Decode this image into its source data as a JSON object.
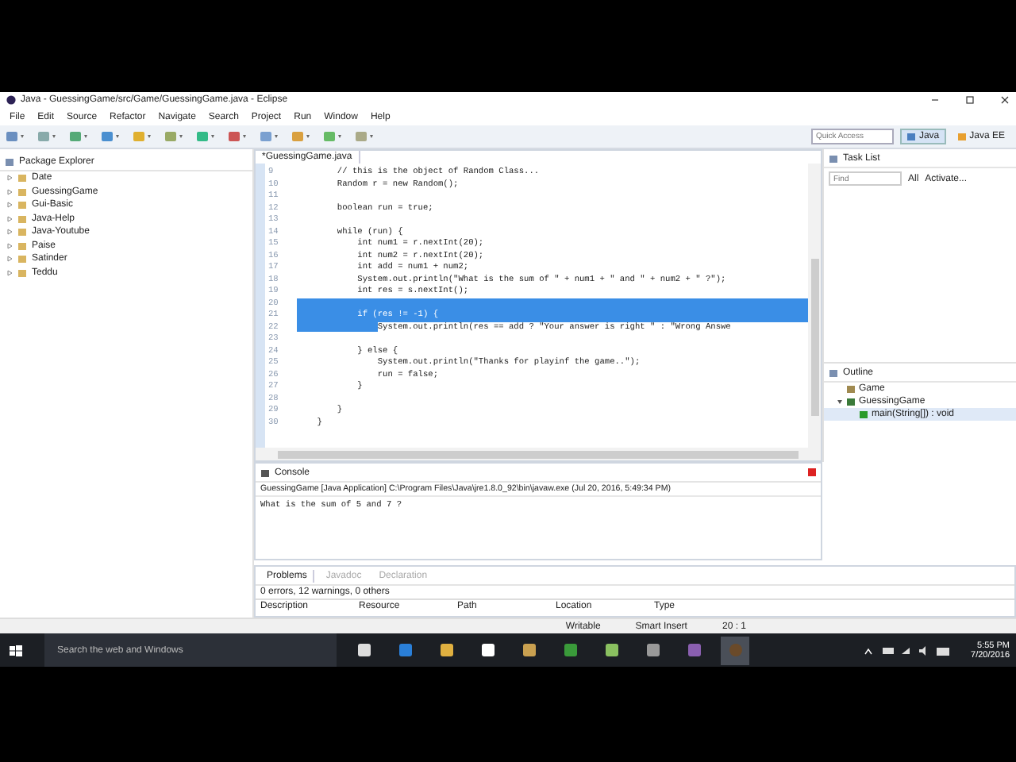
{
  "window": {
    "title": "Java - GuessingGame/src/Game/GuessingGame.java - Eclipse"
  },
  "menu": [
    "File",
    "Edit",
    "Source",
    "Refactor",
    "Navigate",
    "Search",
    "Project",
    "Run",
    "Window",
    "Help"
  ],
  "quick_access": {
    "placeholder": "Quick Access"
  },
  "perspectives": [
    {
      "label": "Java",
      "selected": true
    },
    {
      "label": "Java EE",
      "selected": false
    }
  ],
  "package_explorer": {
    "title": "Package Explorer",
    "items": [
      {
        "label": "Date",
        "expanded": false
      },
      {
        "label": "GuessingGame",
        "expanded": false
      },
      {
        "label": "Gui-Basic",
        "expanded": false
      },
      {
        "label": "Java-Help",
        "expanded": false
      },
      {
        "label": "Java-Youtube",
        "expanded": false
      },
      {
        "label": "Paise",
        "expanded": false
      },
      {
        "label": "Satinder",
        "expanded": false
      },
      {
        "label": "Teddu",
        "expanded": false
      }
    ]
  },
  "editor": {
    "tab": "*GuessingGame.java",
    "lines": [
      {
        "num": "9",
        "text": "        // this is the object of Random Class...",
        "selected": false
      },
      {
        "num": "10",
        "text": "        Random r = new Random();",
        "selected": false
      },
      {
        "num": "11",
        "selected": false
      },
      {
        "num": "12",
        "text": "        boolean run = true;",
        "selected": false
      },
      {
        "num": "13",
        "selected": false
      },
      {
        "num": "14",
        "text": "        while (run) {",
        "selected": false
      },
      {
        "num": "15",
        "text": "            int num1 = r.nextInt(20);",
        "selected": false
      },
      {
        "num": "16",
        "text": "            int num2 = r.nextInt(20);",
        "selected": false
      },
      {
        "num": "17",
        "text": "            int add = num1 + num2;",
        "selected": false
      },
      {
        "num": "18",
        "text": "            System.out.println(\"What is the sum of \" + num1 + \" and \" + num2 + \" ?\");",
        "selected": false
      },
      {
        "num": "19",
        "text": "            int res = s.nextInt();",
        "selected": false
      },
      {
        "num": "20",
        "selected": true
      },
      {
        "num": "21",
        "text": "            if (res != -1) {",
        "selected": true
      },
      {
        "num": "22",
        "text": "                System.out.println(res == add ? \"Your answer is right \" : \"Wrong Answe",
        "selected": false,
        "indent_selected": true
      },
      {
        "num": "23",
        "selected": false
      },
      {
        "num": "24",
        "text": "            } else {",
        "selected": false
      },
      {
        "num": "25",
        "text": "                System.out.println(\"Thanks for playinf the game..\");",
        "selected": false
      },
      {
        "num": "26",
        "text": "                run = false;",
        "selected": false
      },
      {
        "num": "27",
        "text": "            }",
        "selected": false
      },
      {
        "num": "28",
        "selected": false
      },
      {
        "num": "29",
        "text": "        }",
        "selected": false
      },
      {
        "num": "30",
        "text": "    }",
        "selected": false
      }
    ]
  },
  "task_list": {
    "title": "Task List",
    "find": {
      "placeholder": "Find"
    },
    "filters": [
      "All",
      "Activate..."
    ]
  },
  "outline": {
    "title": "Outline",
    "items": [
      {
        "label": "Game",
        "kind": "package"
      },
      {
        "label": "GuessingGame",
        "kind": "class",
        "expanded": true,
        "children": [
          {
            "label": "main(String[]) : void",
            "kind": "method"
          }
        ]
      }
    ]
  },
  "console": {
    "title": "Console",
    "launch": "GuessingGame [Java Application] C:\\Program Files\\Java\\jre1.8.0_92\\bin\\javaw.exe (Jul 20, 2016, 5:49:34 PM)",
    "output": "What is the sum of 5 and 7 ?"
  },
  "problems": {
    "tabs": [
      {
        "label": "Problems",
        "selected": true
      },
      {
        "label": "Javadoc",
        "selected": false
      },
      {
        "label": "Declaration",
        "selected": false
      }
    ],
    "summary": "0 errors, 12 warnings, 0 others",
    "columns": [
      "Description",
      "Resource",
      "Path",
      "Location",
      "Type"
    ]
  },
  "status_bar": [
    "Writable",
    "Smart Insert",
    "20 : 1"
  ],
  "taskbar": {
    "search": {
      "placeholder": "Search the web and Windows"
    },
    "time": "5:55 PM",
    "date": "7/20/2016"
  }
}
